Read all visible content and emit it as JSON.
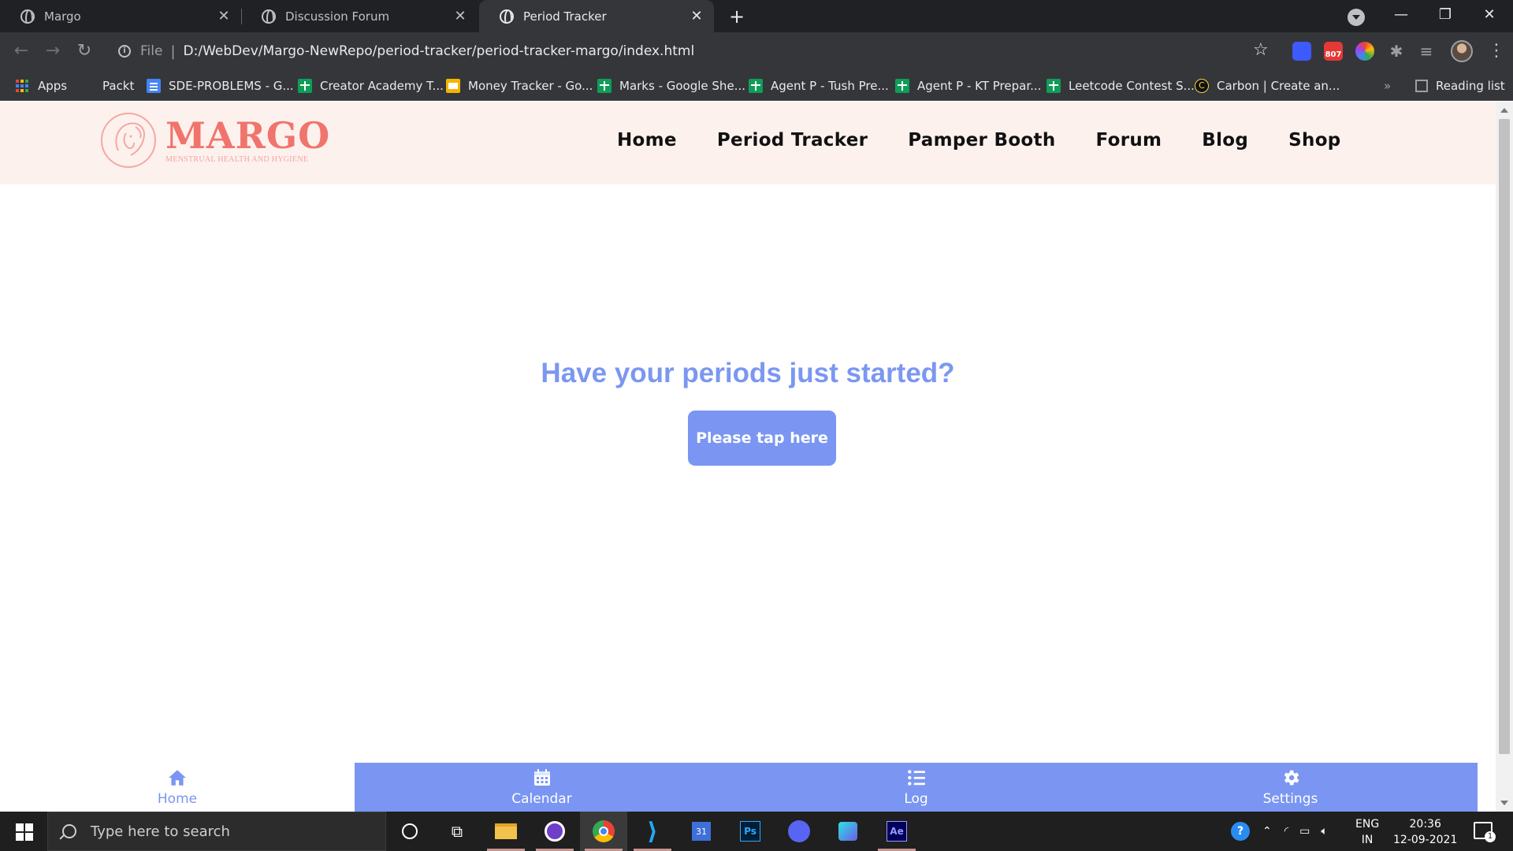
{
  "browser": {
    "tabs": [
      {
        "title": "Margo",
        "active": false
      },
      {
        "title": "Discussion Forum",
        "active": false
      },
      {
        "title": "Period Tracker",
        "active": true
      }
    ],
    "new_tab_symbol": "+",
    "address": {
      "scheme_label": "File",
      "url": "D:/WebDev/Margo-NewRepo/period-tracker/period-tracker-margo/index.html"
    },
    "extension_badge": "807",
    "bookmarks": [
      {
        "label": "Apps",
        "icon": "apps-grid-icon"
      },
      {
        "label": "Packt",
        "icon": "none"
      },
      {
        "label": "SDE-PROBLEMS - G...",
        "icon": "docs-icon"
      },
      {
        "label": "Creator Academy T...",
        "icon": "sheets-icon"
      },
      {
        "label": "Money Tracker - Go...",
        "icon": "slides-icon"
      },
      {
        "label": "Marks - Google She...",
        "icon": "sheets-icon"
      },
      {
        "label": "Agent P - Tush Pre...",
        "icon": "sheets-icon"
      },
      {
        "label": "Agent P - KT Prepar...",
        "icon": "sheets-icon"
      },
      {
        "label": "Leetcode Contest S...",
        "icon": "sheets-icon"
      },
      {
        "label": "Carbon | Create an...",
        "icon": "carbon-icon"
      }
    ],
    "bookmarks_overflow": "»",
    "reading_list": "Reading list"
  },
  "site": {
    "logo_word": "MARGO",
    "logo_tagline": "MENSTRUAL HEALTH AND HYGIENE",
    "nav": [
      "Home",
      "Period Tracker",
      "Pamper Booth",
      "Forum",
      "Blog",
      "Shop"
    ],
    "hero_question": "Have your periods just started?",
    "hero_button": "Please tap here",
    "bottom_nav": [
      {
        "label": "Home",
        "icon": "home-icon",
        "active": true
      },
      {
        "label": "Calendar",
        "icon": "calendar-icon",
        "active": false
      },
      {
        "label": "Log",
        "icon": "list-icon",
        "active": false
      },
      {
        "label": "Settings",
        "icon": "gear-icon",
        "active": false
      }
    ],
    "colors": {
      "accent": "#7a96f2",
      "header_bg": "#fdf1ee",
      "logo": "#f0746c"
    }
  },
  "taskbar": {
    "search_placeholder": "Type here to search",
    "language": "ENG",
    "region": "IN",
    "time": "20:36",
    "date": "12-09-2021",
    "notification_count": "1"
  }
}
